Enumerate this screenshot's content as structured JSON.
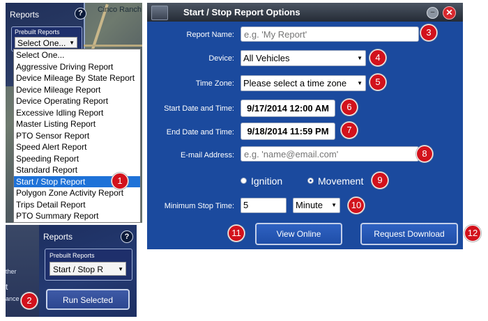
{
  "panel_a": {
    "reports_title": "Reports",
    "help_icon": "question-mark-icon",
    "map_label": "Cinco Ranch",
    "prebuilt_label": "Prebuilt Reports",
    "select_value": "Select One...",
    "options": [
      "Select One...",
      "Aggressive Driving Report",
      "Device Mileage By State Report",
      "Device Mileage Report",
      "Device Operating Report",
      "Excessive Idling Report",
      "Master Listing Report",
      "PTO Sensor Report",
      "Speed Alert Report",
      "Speeding Report",
      "Standard Report",
      "Start / Stop Report",
      "Polygon Zone Activity Report",
      "Trips Detail Report",
      "PTO Summary Report"
    ],
    "selected_option": "Start / Stop Report"
  },
  "panel_b": {
    "reports_title": "Reports",
    "help_icon": "question-mark-icon",
    "side_text_1": "ther",
    "side_text_2": "t",
    "side_text_3": "ance",
    "prebuilt_label": "Prebuilt Reports",
    "select_value": "Start / Stop R",
    "run_button": "Run Selected"
  },
  "dialog": {
    "title": "Start / Stop Report Options",
    "minimize_icon": "minus-icon",
    "close_icon": "close-icon",
    "report_name_label": "Report Name:",
    "report_name_placeholder": "e.g. 'My Report'",
    "device_label": "Device:",
    "device_value": "All Vehicles",
    "timezone_label": "Time Zone:",
    "timezone_value": "Please select a time zone",
    "start_label": "Start Date and Time:",
    "start_value": "9/17/2014 12:00 AM",
    "end_label": "End Date and Time:",
    "end_value": "9/18/2014 11:59 PM",
    "email_label": "E-mail Address:",
    "email_placeholder": "e.g. 'name@email.com'",
    "radio_ignition": "Ignition",
    "radio_movement": "Movement",
    "radio_selected": "Movement",
    "min_stop_label": "Minimum Stop Time:",
    "min_stop_value": "5",
    "min_stop_unit": "Minute",
    "view_online_button": "View Online",
    "request_download_button": "Request Download"
  },
  "badges": [
    "1",
    "2",
    "3",
    "4",
    "5",
    "6",
    "7",
    "8",
    "9",
    "10",
    "11",
    "12"
  ],
  "colors": {
    "badge_red": "#d2121c",
    "dialog_blue": "#1b4a9e",
    "selected_blue": "#1e72d8"
  }
}
